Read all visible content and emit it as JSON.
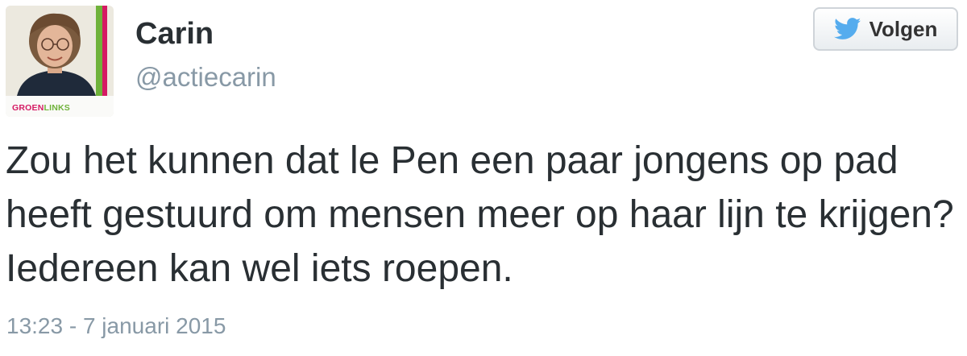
{
  "tweet": {
    "author": {
      "name": "Carin",
      "handle": "@actiecarin",
      "avatar_brand_left": "GROEN",
      "avatar_brand_right": "LINKS"
    },
    "follow_button": {
      "label": "Volgen",
      "icon": "twitter-bird-icon"
    },
    "text": "Zou het kunnen dat le Pen een paar jongens op pad heeft gestuurd om mensen meer op haar lijn te krijgen? Iedereen kan wel iets roepen.",
    "timestamp": "13:23 - 7 januari 2015"
  },
  "colors": {
    "name": "#292f33",
    "handle": "#8899a6",
    "twitter_blue": "#55acee",
    "brand_pink": "#d51a63",
    "brand_green": "#6fb23a"
  }
}
